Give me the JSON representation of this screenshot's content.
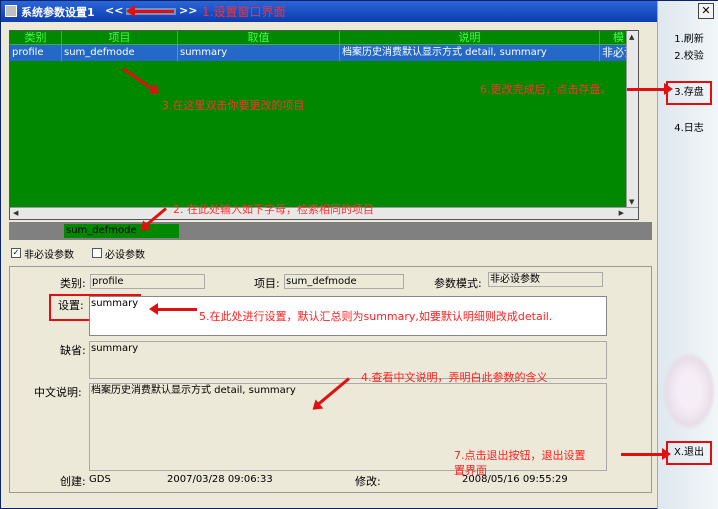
{
  "window": {
    "title": "系统参数设置1",
    "nav_prev": "<<",
    "nav_next": ">>",
    "title_annotation": "1.设置窗口界面"
  },
  "side_buttons": {
    "refresh": "1.刷新",
    "verify": "2.校验",
    "save": "3.存盘",
    "log": "4.日志",
    "exit": "X.退出",
    "close": "✕"
  },
  "grid": {
    "columns": [
      "类别",
      "项目",
      "取值",
      "说明",
      "模"
    ],
    "rows": [
      {
        "category": "profile",
        "item": "sum_defmode",
        "value": "summary",
        "desc": "档案历史消费默认显示方式 detail, summary",
        "mode": "非必设"
      }
    ],
    "annotation_select": "3.在这里双击你要更改的项目",
    "annotation_save": "6.更改完成后，点击存盘。"
  },
  "filter": {
    "value": "sum_defmode",
    "annotation": "2. 在此处输入如下字母，检索相同的项目"
  },
  "checkboxes": [
    {
      "label": "非必设参数",
      "checked": true,
      "mark": "✓"
    },
    {
      "label": "必设参数",
      "checked": false,
      "mark": ""
    }
  ],
  "detail": {
    "category_label": "类别:",
    "category_value": "profile",
    "item_label": "项目:",
    "item_value": "sum_defmode",
    "mode_label": "参数模式:",
    "mode_value": "非必设参数",
    "setting_label": "设置:",
    "setting_value": "summary",
    "setting_annotation": "5.在此处进行设置，默认汇总则为summary,如要默认明细则改成detail.",
    "default_label": "缺省:",
    "default_value": "summary",
    "desc_label": "中文说明:",
    "desc_value": "档案历史消费默认显示方式 detail, summary",
    "desc_annotation": "4.查看中文说明，弄明白此参数的含义",
    "exit_annotation_1": "7.点击退出按钮，退出设置",
    "exit_annotation_2": "置界面",
    "created_label": "创建:",
    "created_by": "GDS",
    "created_time": "2007/03/28 09:06:33",
    "modified_label": "修改:",
    "modified_time": "2008/05/16 09:55:29"
  }
}
